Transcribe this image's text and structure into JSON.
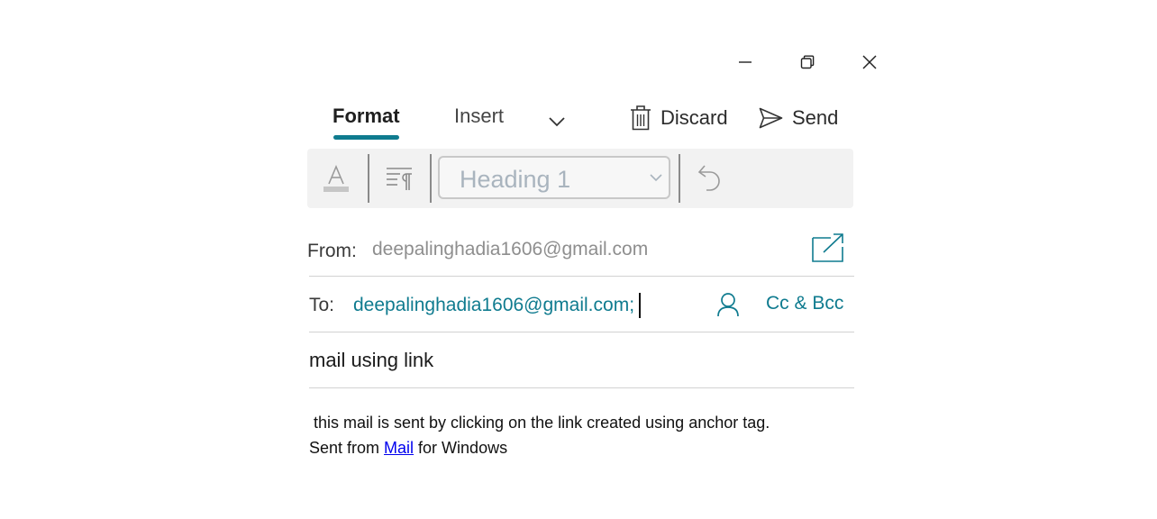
{
  "window": {
    "controls": [
      "minimize-icon",
      "restore-icon",
      "close-icon"
    ]
  },
  "ribbon": {
    "tabs": [
      {
        "label": "Format",
        "active": true
      },
      {
        "label": "Insert",
        "active": false
      }
    ],
    "more_icon": "chevron-down-icon",
    "discard_label": "Discard",
    "send_label": "Send",
    "accent_color": "#0f7b8f"
  },
  "toolbar": {
    "font_icon": "font-color-icon",
    "paragraph_icon": "paragraph-icon",
    "style_value": "Heading 1",
    "undo_icon": "undo-icon"
  },
  "from": {
    "label": "From:",
    "value": "deepalinghadia1606@gmail.com"
  },
  "to": {
    "label": "To:",
    "value": "deepalinghadia1606@gmail.com;",
    "ccbcc_label": "Cc & Bcc"
  },
  "subject": {
    "value": "mail using link"
  },
  "body": {
    "line1": " this mail is sent by clicking on the link created using anchor tag.",
    "line2_prefix": "Sent from ",
    "link_text": "Mail",
    "line2_suffix": " for Windows"
  }
}
